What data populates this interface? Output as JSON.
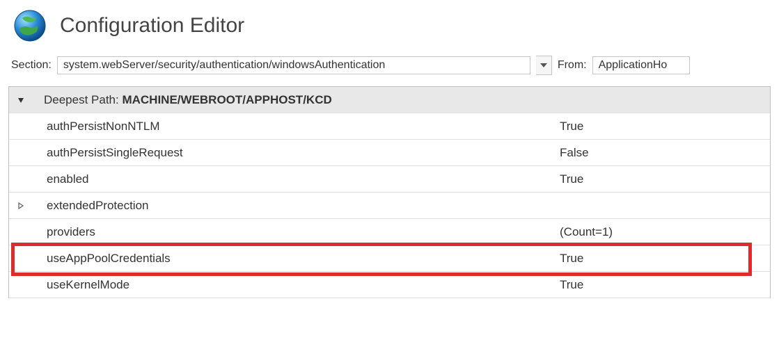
{
  "header": {
    "title": "Configuration Editor"
  },
  "toolbar": {
    "section_label": "Section:",
    "section_value": "system.webServer/security/authentication/windowsAuthentication",
    "from_label": "From:",
    "from_value": "ApplicationHo"
  },
  "grid": {
    "header_prefix": "Deepest Path: ",
    "header_path": "MACHINE/WEBROOT/APPHOST/KCD",
    "rows": [
      {
        "name": "authPersistNonNTLM",
        "value": "True",
        "expandable": false
      },
      {
        "name": "authPersistSingleRequest",
        "value": "False",
        "expandable": false
      },
      {
        "name": "enabled",
        "value": "True",
        "expandable": false
      },
      {
        "name": "extendedProtection",
        "value": "",
        "expandable": true
      },
      {
        "name": "providers",
        "value": "(Count=1)",
        "expandable": false
      },
      {
        "name": "useAppPoolCredentials",
        "value": "True",
        "expandable": false
      },
      {
        "name": "useKernelMode",
        "value": "True",
        "expandable": false
      }
    ]
  }
}
